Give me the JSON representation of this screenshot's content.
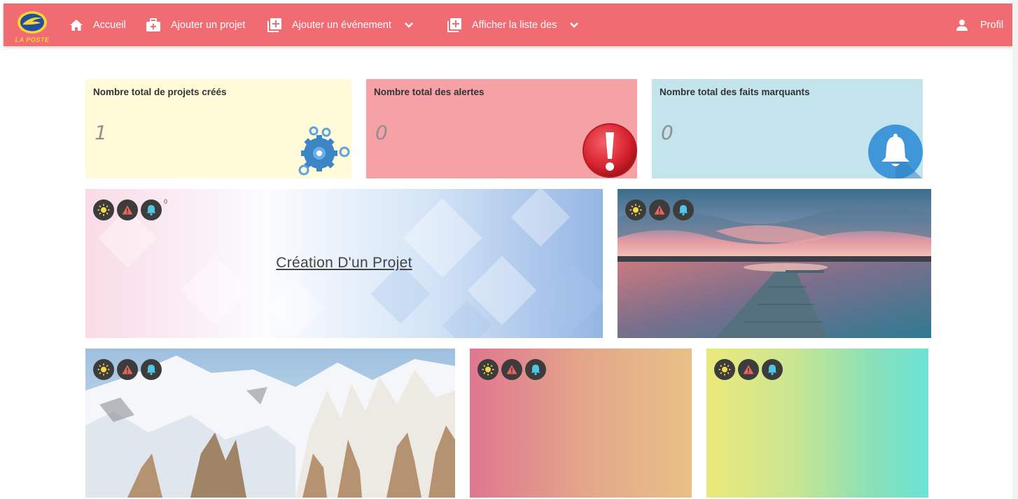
{
  "brand": {
    "logo_text": "LA POSTE"
  },
  "nav": {
    "home_label": "Accueil",
    "add_project_label": "Ajouter un projet",
    "add_event_label": "Ajouter un événement",
    "list_label": "Afficher la liste des",
    "profile_label": "Profil",
    "icons": [
      "home-icon",
      "briefcase-add-icon",
      "add-box-icon",
      "chevron-down-icon",
      "add-box-icon",
      "chevron-down-icon",
      "person-icon"
    ]
  },
  "stats": {
    "projects": {
      "title": "Nombre total de projets créés",
      "value": "1",
      "icon": "gears-icon"
    },
    "alerts": {
      "title": "Nombre total des alertes",
      "value": "0",
      "icon": "exclamation-icon"
    },
    "facts": {
      "title": "Nombre total des faits marquants",
      "value": "0",
      "icon": "bell-icon"
    }
  },
  "tiles": [
    {
      "link": "Création D'un Projet",
      "counter": "0",
      "background": "abstract-diamonds"
    },
    {
      "background": "lake-sunset-pier"
    },
    {
      "background": "snowy-mountains"
    },
    {
      "background": "gradient-pink-orange"
    },
    {
      "background": "gradient-yellow-cyan"
    }
  ],
  "badge_icons": [
    "sun-icon",
    "warning-icon",
    "bell-icon"
  ],
  "colors": {
    "navbar": "#f06b72",
    "card_projects": "#fffbd8",
    "card_alerts": "#f6a1a5",
    "card_facts": "#c3e3ed",
    "badge_bg": "#3c3c3c",
    "sun": "#f6d84a",
    "warning": "#e8645c",
    "bell": "#4fc7e4"
  }
}
